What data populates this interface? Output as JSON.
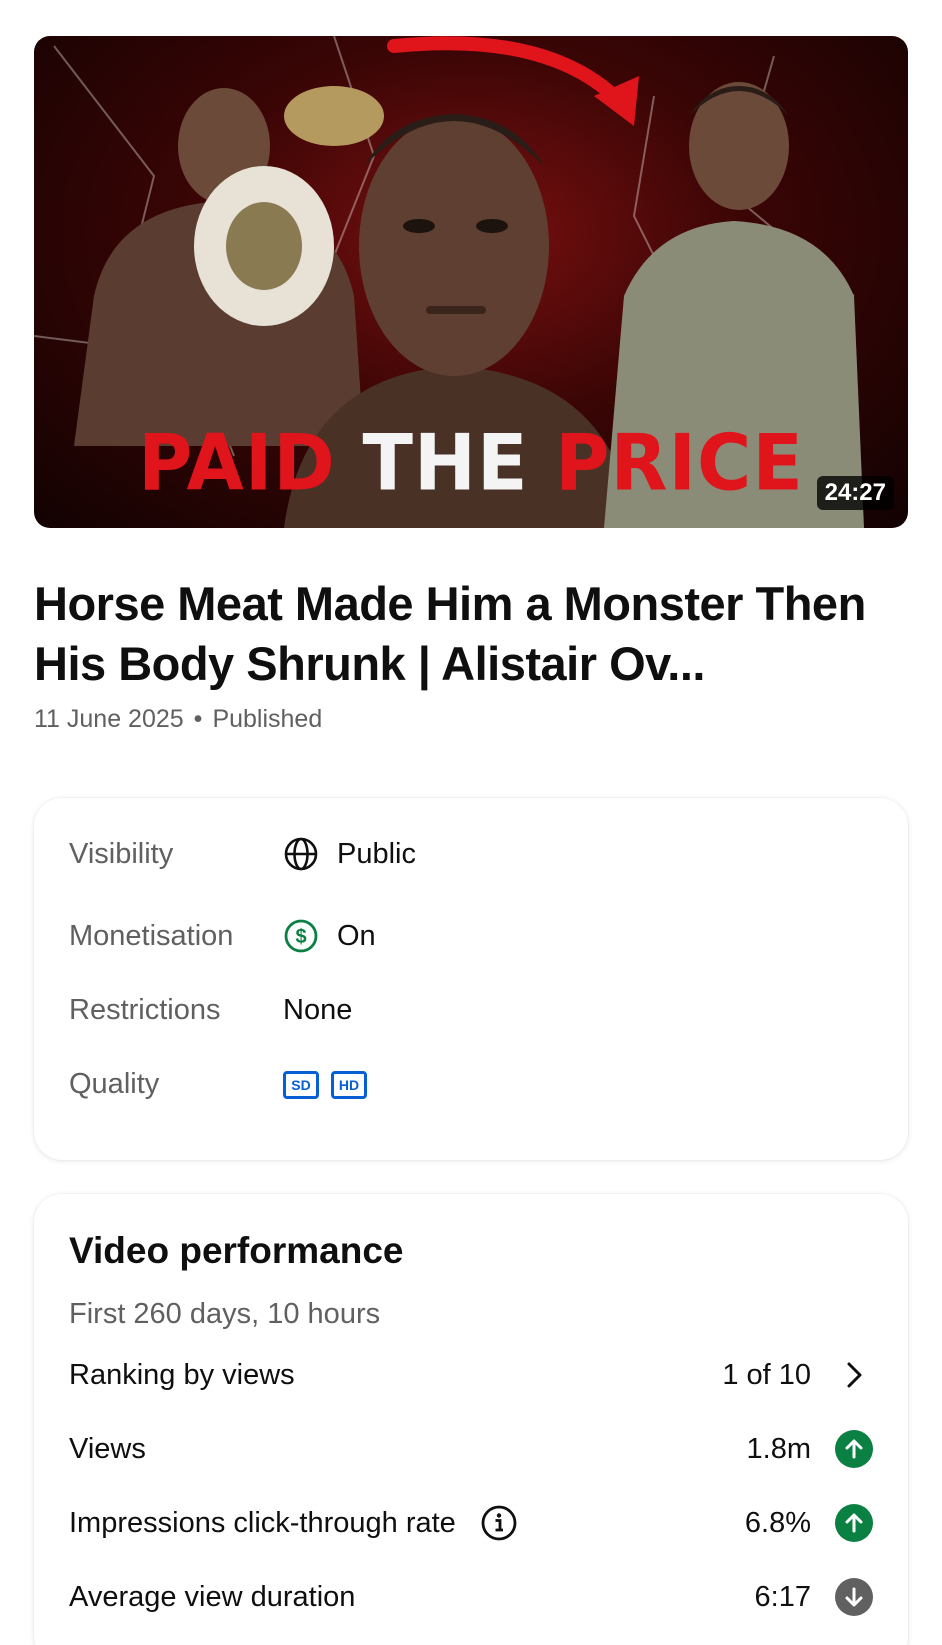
{
  "video": {
    "thumbnail_text": {
      "part1": "PAID",
      "part2": "THE",
      "part3": "PRICE"
    },
    "duration": "24:27",
    "title": "Horse Meat Made Him a Monster Then His Body Shrunk | Alistair Ov...",
    "date": "11 June 2025",
    "separator": "•",
    "status": "Published"
  },
  "details": {
    "visibility": {
      "label": "Visibility",
      "value": "Public",
      "icon": "globe-icon"
    },
    "monetisation": {
      "label": "Monetisation",
      "value": "On",
      "icon": "dollar-circle-icon",
      "color": "#0b8043"
    },
    "restrictions": {
      "label": "Restrictions",
      "value": "None"
    },
    "quality": {
      "label": "Quality",
      "badges": [
        "SD",
        "HD"
      ],
      "color": "#065fd4"
    }
  },
  "performance": {
    "title": "Video performance",
    "period": "First 260 days, 10 hours",
    "ranking": {
      "label": "Ranking by views",
      "value": "1 of 10",
      "icon": "chevron-right-icon"
    },
    "views": {
      "label": "Views",
      "value": "1.8m",
      "trend": "up"
    },
    "ctr": {
      "label": "Impressions click-through rate",
      "value": "6.8%",
      "trend": "up",
      "icon": "info-icon"
    },
    "avd": {
      "label": "Average view duration",
      "value": "6:17",
      "trend": "down"
    }
  },
  "colors": {
    "trend_up": "#0b8043",
    "trend_down": "#606060",
    "accent_blue": "#065fd4"
  }
}
